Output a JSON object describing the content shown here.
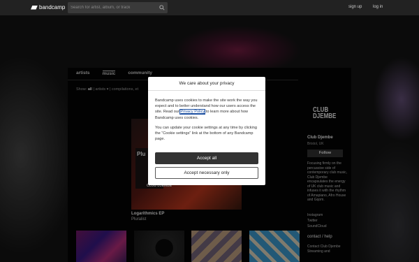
{
  "topbar": {
    "logo_text": "bandcamp",
    "search_placeholder": "Search for artist, album, or track",
    "signup": "sign up",
    "login": "log in"
  },
  "tabs": [
    {
      "label": "artists",
      "active": false
    },
    {
      "label": "music",
      "active": true
    },
    {
      "label": "community",
      "active": false
    }
  ],
  "filter": {
    "show_label": "Show:",
    "all": "all",
    "artists": "| artists ▾",
    "compilations": "| compilations, et"
  },
  "featured": {
    "art_text": "Plu",
    "art_label": "CLUB DJEMBE",
    "title": "Logarithmics EP",
    "artist": "Pluralist"
  },
  "sidebar": {
    "logo": "CLUB DJEMBE",
    "name": "Club Djembe",
    "location": "Bristol, UK",
    "follow": "Follow",
    "bio": "Focusing firmly on the percussive side of contemporary club music, Club Djembe encapsulates the energy of UK club music and infuses it with the rhythm of Amapiano, Afro House and Gqom.",
    "links": [
      "Instagram",
      "Twitter",
      "SoundCloud"
    ],
    "contact_head": "contact / help",
    "contact_link": "Contact Club Djembe",
    "streaming": "Streaming and"
  },
  "modal": {
    "title": "We care about your privacy",
    "p1_before": "Bandcamp uses cookies to make the site work the way you expect and to better understand how our users access the site. Read our ",
    "p1_link": "Privacy Policy",
    "p1_after": " to learn more about how Bandcamp uses cookies.",
    "p2": "You can update your cookie settings at any time by clicking the “Cookie settings” link at the bottom of any Bandcamp page.",
    "accept_all": "Accept all",
    "accept_necessary": "Accept necessary only"
  }
}
